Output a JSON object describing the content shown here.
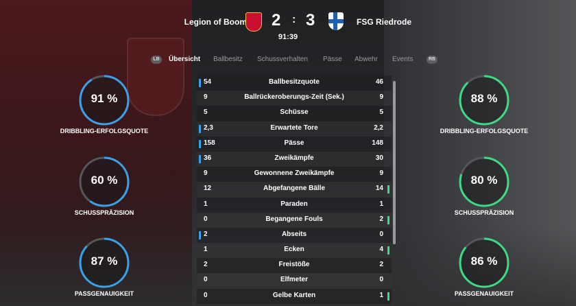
{
  "match": {
    "home_team": "Legion of Boom",
    "away_team": "FSG Riedrode",
    "home_score": "2",
    "separator": ":",
    "away_score": "3",
    "clock": "91:39"
  },
  "tabs": {
    "lb_hint": "LB",
    "rb_hint": "RB",
    "items": [
      "Übersicht",
      "Ballbesitz",
      "Schussverhalten",
      "Pässe",
      "Abwehr",
      "Events"
    ],
    "active": "Übersicht"
  },
  "stats": [
    {
      "label": "Ballbesitzquote",
      "home": "54",
      "away": "46",
      "lead": "home"
    },
    {
      "label": "Ballrückeroberungs-Zeit (Sek.)",
      "home": "9",
      "away": "9",
      "lead": "none"
    },
    {
      "label": "Schüsse",
      "home": "5",
      "away": "5",
      "lead": "none"
    },
    {
      "label": "Erwartete Tore",
      "home": "2,3",
      "away": "2,2",
      "lead": "home"
    },
    {
      "label": "Pässe",
      "home": "158",
      "away": "148",
      "lead": "home"
    },
    {
      "label": "Zweikämpfe",
      "home": "36",
      "away": "30",
      "lead": "home"
    },
    {
      "label": "Gewonnene Zweikämpfe",
      "home": "9",
      "away": "9",
      "lead": "none"
    },
    {
      "label": "Abgefangene Bälle",
      "home": "12",
      "away": "14",
      "lead": "away"
    },
    {
      "label": "Paraden",
      "home": "1",
      "away": "1",
      "lead": "none"
    },
    {
      "label": "Begangene Fouls",
      "home": "0",
      "away": "2",
      "lead": "away"
    },
    {
      "label": "Abseits",
      "home": "2",
      "away": "0",
      "lead": "home"
    },
    {
      "label": "Ecken",
      "home": "1",
      "away": "4",
      "lead": "away"
    },
    {
      "label": "Freistöße",
      "home": "2",
      "away": "2",
      "lead": "none"
    },
    {
      "label": "Elfmeter",
      "home": "0",
      "away": "0",
      "lead": "none"
    },
    {
      "label": "Gelbe Karten",
      "home": "0",
      "away": "1",
      "lead": "away"
    }
  ],
  "home_rings": [
    {
      "value": "91 %",
      "fraction": 0.91,
      "label": "DRIBBLING-ERFOLGSQUOTE"
    },
    {
      "value": "60 %",
      "fraction": 0.6,
      "label": "SCHUSSPRÄZISION"
    },
    {
      "value": "87 %",
      "fraction": 0.87,
      "label": "PASSGENAUIGKEIT"
    }
  ],
  "away_rings": [
    {
      "value": "88 %",
      "fraction": 0.88,
      "label": "DRIBBLING-ERFOLGSQUOTE"
    },
    {
      "value": "80 %",
      "fraction": 0.8,
      "label": "SCHUSSPRÄZISION"
    },
    {
      "value": "86 %",
      "fraction": 0.86,
      "label": "PASSGENAUIGKEIT"
    }
  ],
  "colors": {
    "home_accent": "#3aa0e8",
    "away_accent": "#3ddc84",
    "ring_track": "#55575b"
  }
}
